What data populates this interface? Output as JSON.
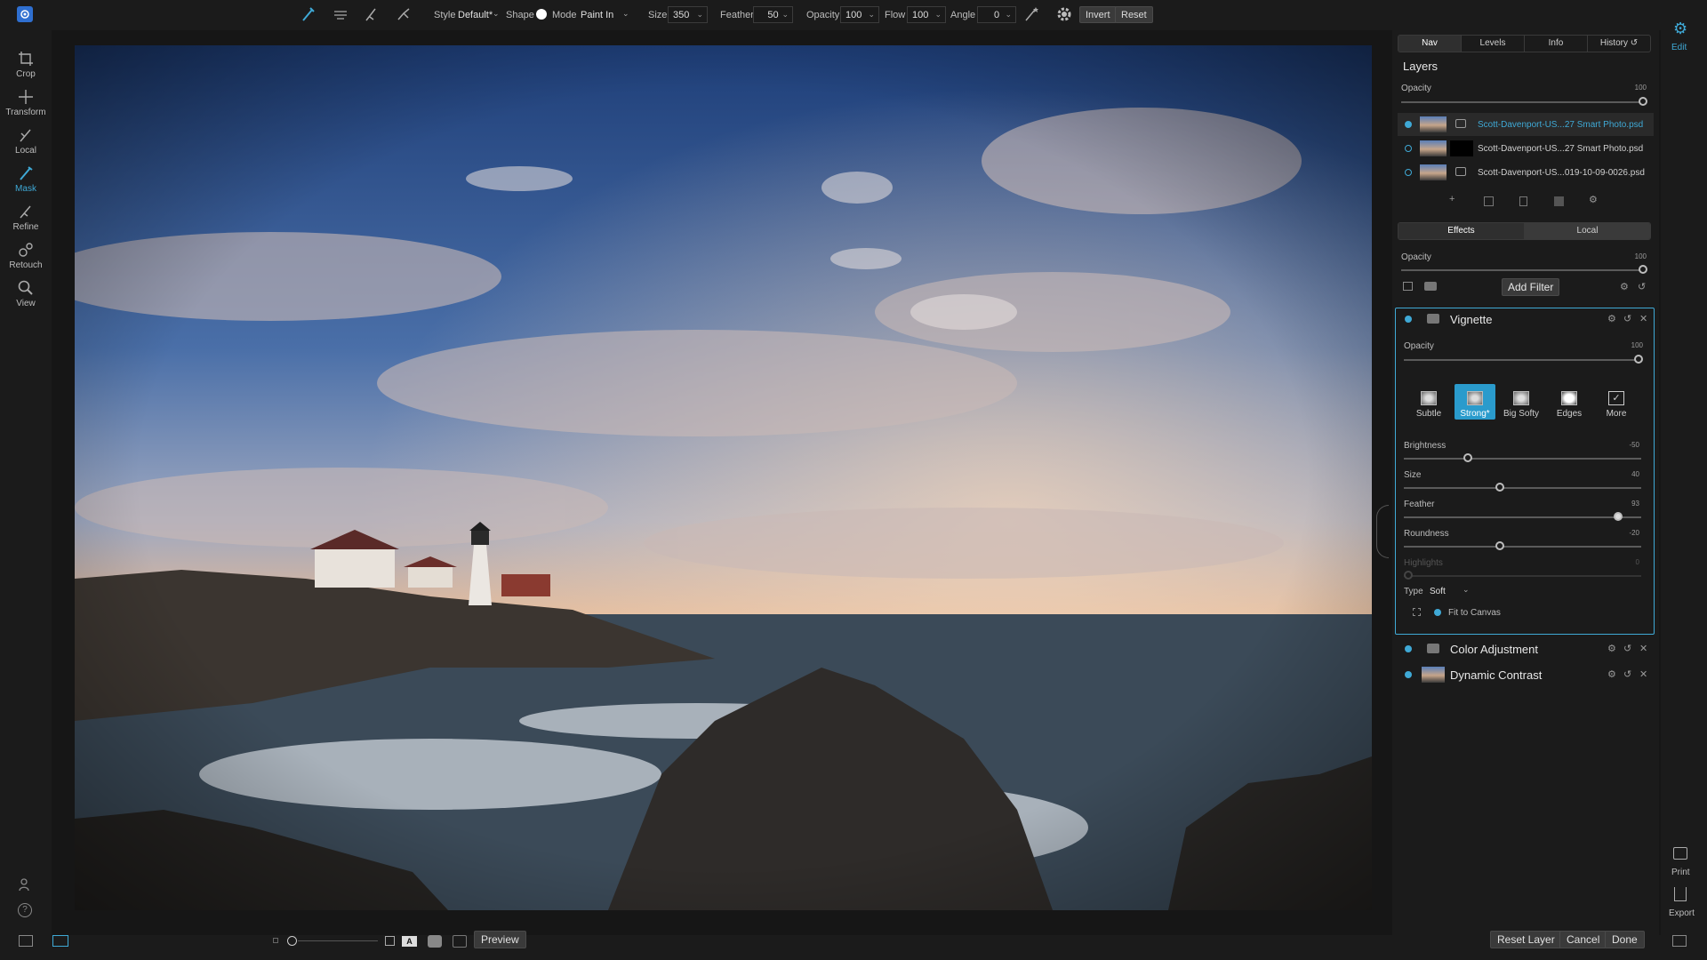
{
  "toolbar": {
    "style_label": "Style",
    "style_value": "Default*",
    "shape_label": "Shape",
    "mode_label": "Mode",
    "mode_value": "Paint In",
    "size_label": "Size",
    "size_value": "350",
    "feather_label": "Feather",
    "feather_value": "50",
    "opacity_label": "Opacity",
    "opacity_value": "100",
    "flow_label": "Flow",
    "flow_value": "100",
    "angle_label": "Angle",
    "angle_value": "0",
    "invert_label": "Invert",
    "reset_label": "Reset"
  },
  "left_tools": [
    {
      "label": "Crop",
      "icon": "crop-icon"
    },
    {
      "label": "Transform",
      "icon": "transform-icon"
    },
    {
      "label": "Local",
      "icon": "brush-icon"
    },
    {
      "label": "Mask",
      "icon": "mask-brush-icon",
      "active": true
    },
    {
      "label": "Refine",
      "icon": "refine-brush-icon"
    },
    {
      "label": "Retouch",
      "icon": "retouch-icon"
    },
    {
      "label": "View",
      "icon": "zoom-icon"
    }
  ],
  "right_strip": {
    "edit_label": "Edit",
    "print_label": "Print",
    "export_label": "Export"
  },
  "panel": {
    "tabs": [
      "Nav",
      "Levels",
      "Info",
      "History"
    ],
    "layers_title": "Layers",
    "layers_opacity_label": "Opacity",
    "layers_opacity_value": "100",
    "layers": [
      {
        "name": "Scott-Davenport-US...27 Smart Photo.psd",
        "selected": true
      },
      {
        "name": "Scott-Davenport-US...27 Smart Photo.psd",
        "selected": false
      },
      {
        "name": "Scott-Davenport-US...019-10-09-0026.psd",
        "selected": false
      }
    ],
    "effects_tabs": [
      "Effects",
      "Local"
    ],
    "effects_opacity_label": "Opacity",
    "effects_opacity_value": "100",
    "add_filter_label": "Add Filter",
    "vignette": {
      "title": "Vignette",
      "opacity_label": "Opacity",
      "opacity_value": "100",
      "presets": [
        "Subtle",
        "Strong*",
        "Big Softy",
        "Edges",
        "More"
      ],
      "sliders": [
        {
          "label": "Brightness",
          "value": "-50",
          "level": 0.26
        },
        {
          "label": "Size",
          "value": "40",
          "level": 0.4
        },
        {
          "label": "Feather",
          "value": "93",
          "level": 0.92
        },
        {
          "label": "Roundness",
          "value": "-20",
          "level": 0.4
        },
        {
          "label": "Highlights",
          "value": "0",
          "level": 0.0
        }
      ],
      "type_label": "Type",
      "type_value": "Soft",
      "fit_label": "Fit to Canvas"
    },
    "other_filters": [
      "Color Adjustment",
      "Dynamic Contrast"
    ]
  },
  "bottom": {
    "preview_label": "Preview",
    "reset_layer_label": "Reset Layer",
    "cancel_label": "Cancel",
    "done_label": "Done"
  }
}
